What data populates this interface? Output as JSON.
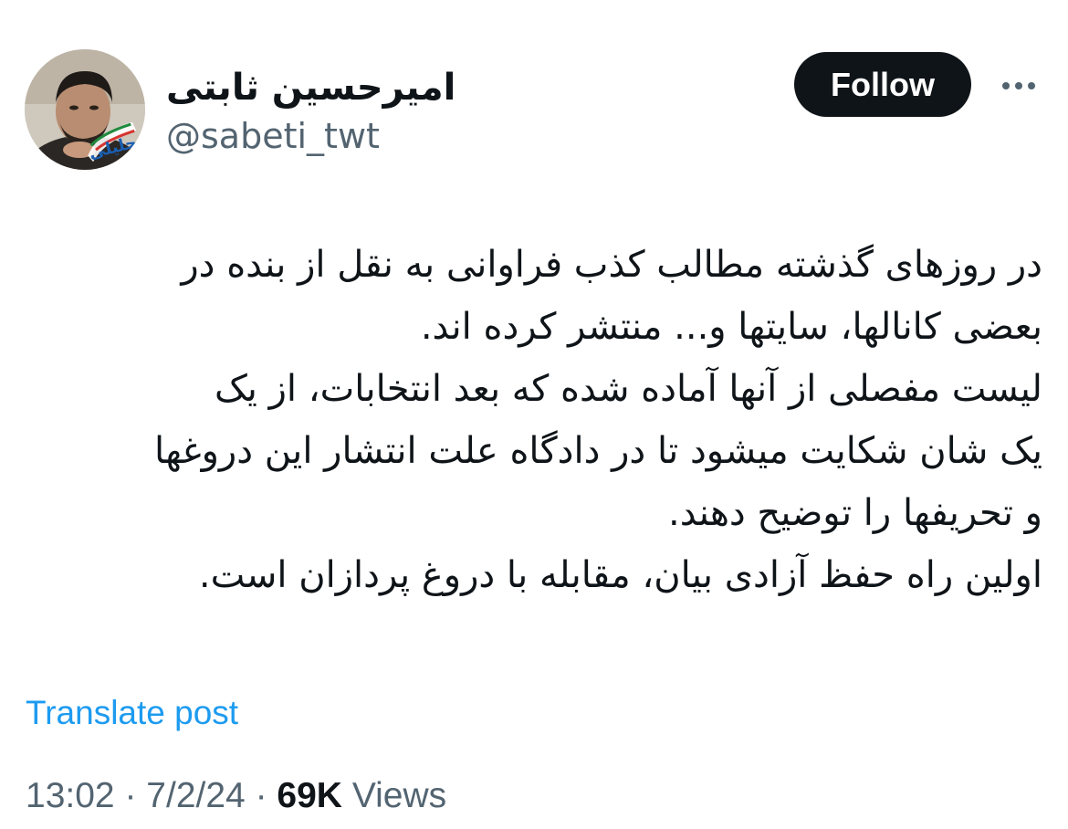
{
  "author": {
    "display_name": "امیرحسین ثابتی",
    "handle": "@sabeti_twt",
    "avatar_badge_text": "جلیلی"
  },
  "actions": {
    "follow_label": "Follow",
    "more_icon": "more-dots-icon"
  },
  "tweet": {
    "lines": [
      "در روزهای گذشته مطالب کذب فراوانی به نقل از بنده در",
      "بعضی کانالها، سایتها و... منتشر کرده اند.",
      "لیست مفصلی از آنها آماده شده که بعد انتخابات، از یک",
      "یک شان شکایت میشود تا در دادگاه علت انتشار این دروغها",
      "و تحریفها را توضیح دهند.",
      "اولین راه حفظ آزادی بیان، مقابله با دروغ پردازان است."
    ]
  },
  "translate_label": "Translate post",
  "meta": {
    "time": "13:02",
    "separator": "·",
    "date": "7/2/24",
    "views_count": "69K",
    "views_label": "Views"
  },
  "colors": {
    "text": "#0f1419",
    "secondary": "#536471",
    "link": "#1d9bf0",
    "follow_bg": "#0f1419"
  }
}
